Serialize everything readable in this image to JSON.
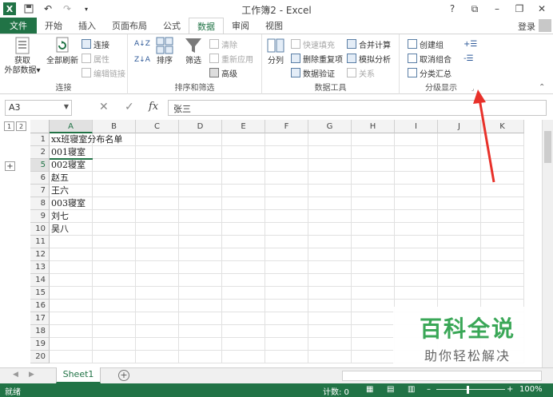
{
  "window": {
    "title": "工作簿2 - Excel",
    "logo": "X",
    "buttons": [
      "?",
      "⧉",
      "–",
      "❐",
      "✕"
    ]
  },
  "tabs": [
    "文件",
    "开始",
    "插入",
    "页面布局",
    "公式",
    "数据",
    "审阅",
    "视图"
  ],
  "active_tab": "数据",
  "login": "登录",
  "ribbon": {
    "get_external": "获取\n外部数据",
    "refresh_all": "全部刷新",
    "connections": "连接",
    "properties": "属性",
    "edit_links": "编辑链接",
    "group_connections": "连接",
    "sort": "排序",
    "filter": "筛选",
    "clear": "清除",
    "reapply": "重新应用",
    "advanced": "高级",
    "group_sort_filter": "排序和筛选",
    "text_to_columns": "分列",
    "flash_fill": "快速填充",
    "remove_dup": "删除重复项",
    "data_validation": "数据验证",
    "consolidate": "合并计算",
    "what_if": "模拟分析",
    "relationships": "关系",
    "group_data_tools": "数据工具",
    "group": "创建组",
    "ungroup": "取消组合",
    "subtotal": "分类汇总",
    "group_outline": "分级显示"
  },
  "formula_bar": {
    "name_box": "A3",
    "content": "张三"
  },
  "columns": [
    "A",
    "B",
    "C",
    "D",
    "E",
    "F",
    "G",
    "H",
    "I",
    "J",
    "K"
  ],
  "rows": [
    {
      "num": "1",
      "a": "xx班寝室分布名单"
    },
    {
      "num": "2",
      "a": "001寝室"
    },
    {
      "num": "5",
      "a": "002寝室"
    },
    {
      "num": "6",
      "a": "赵五"
    },
    {
      "num": "7",
      "a": "王六"
    },
    {
      "num": "8",
      "a": "003寝室"
    },
    {
      "num": "9",
      "a": "刘七"
    },
    {
      "num": "10",
      "a": "吴八"
    },
    {
      "num": "11",
      "a": ""
    },
    {
      "num": "12",
      "a": ""
    },
    {
      "num": "13",
      "a": ""
    },
    {
      "num": "14",
      "a": ""
    },
    {
      "num": "15",
      "a": ""
    },
    {
      "num": "16",
      "a": ""
    },
    {
      "num": "17",
      "a": ""
    },
    {
      "num": "18",
      "a": ""
    },
    {
      "num": "19",
      "a": ""
    },
    {
      "num": "20",
      "a": ""
    }
  ],
  "outline": {
    "level1": "1",
    "level2": "2",
    "expand": "+"
  },
  "sheet_tab": "Sheet1",
  "status": {
    "ready": "就绪",
    "count": "计数: 0",
    "zoom": "100%"
  },
  "watermark": {
    "main": "百科全说",
    "sub": "助你轻松解决"
  },
  "colors": {
    "excel_green": "#217346",
    "arrow_red": "#e8312a"
  }
}
